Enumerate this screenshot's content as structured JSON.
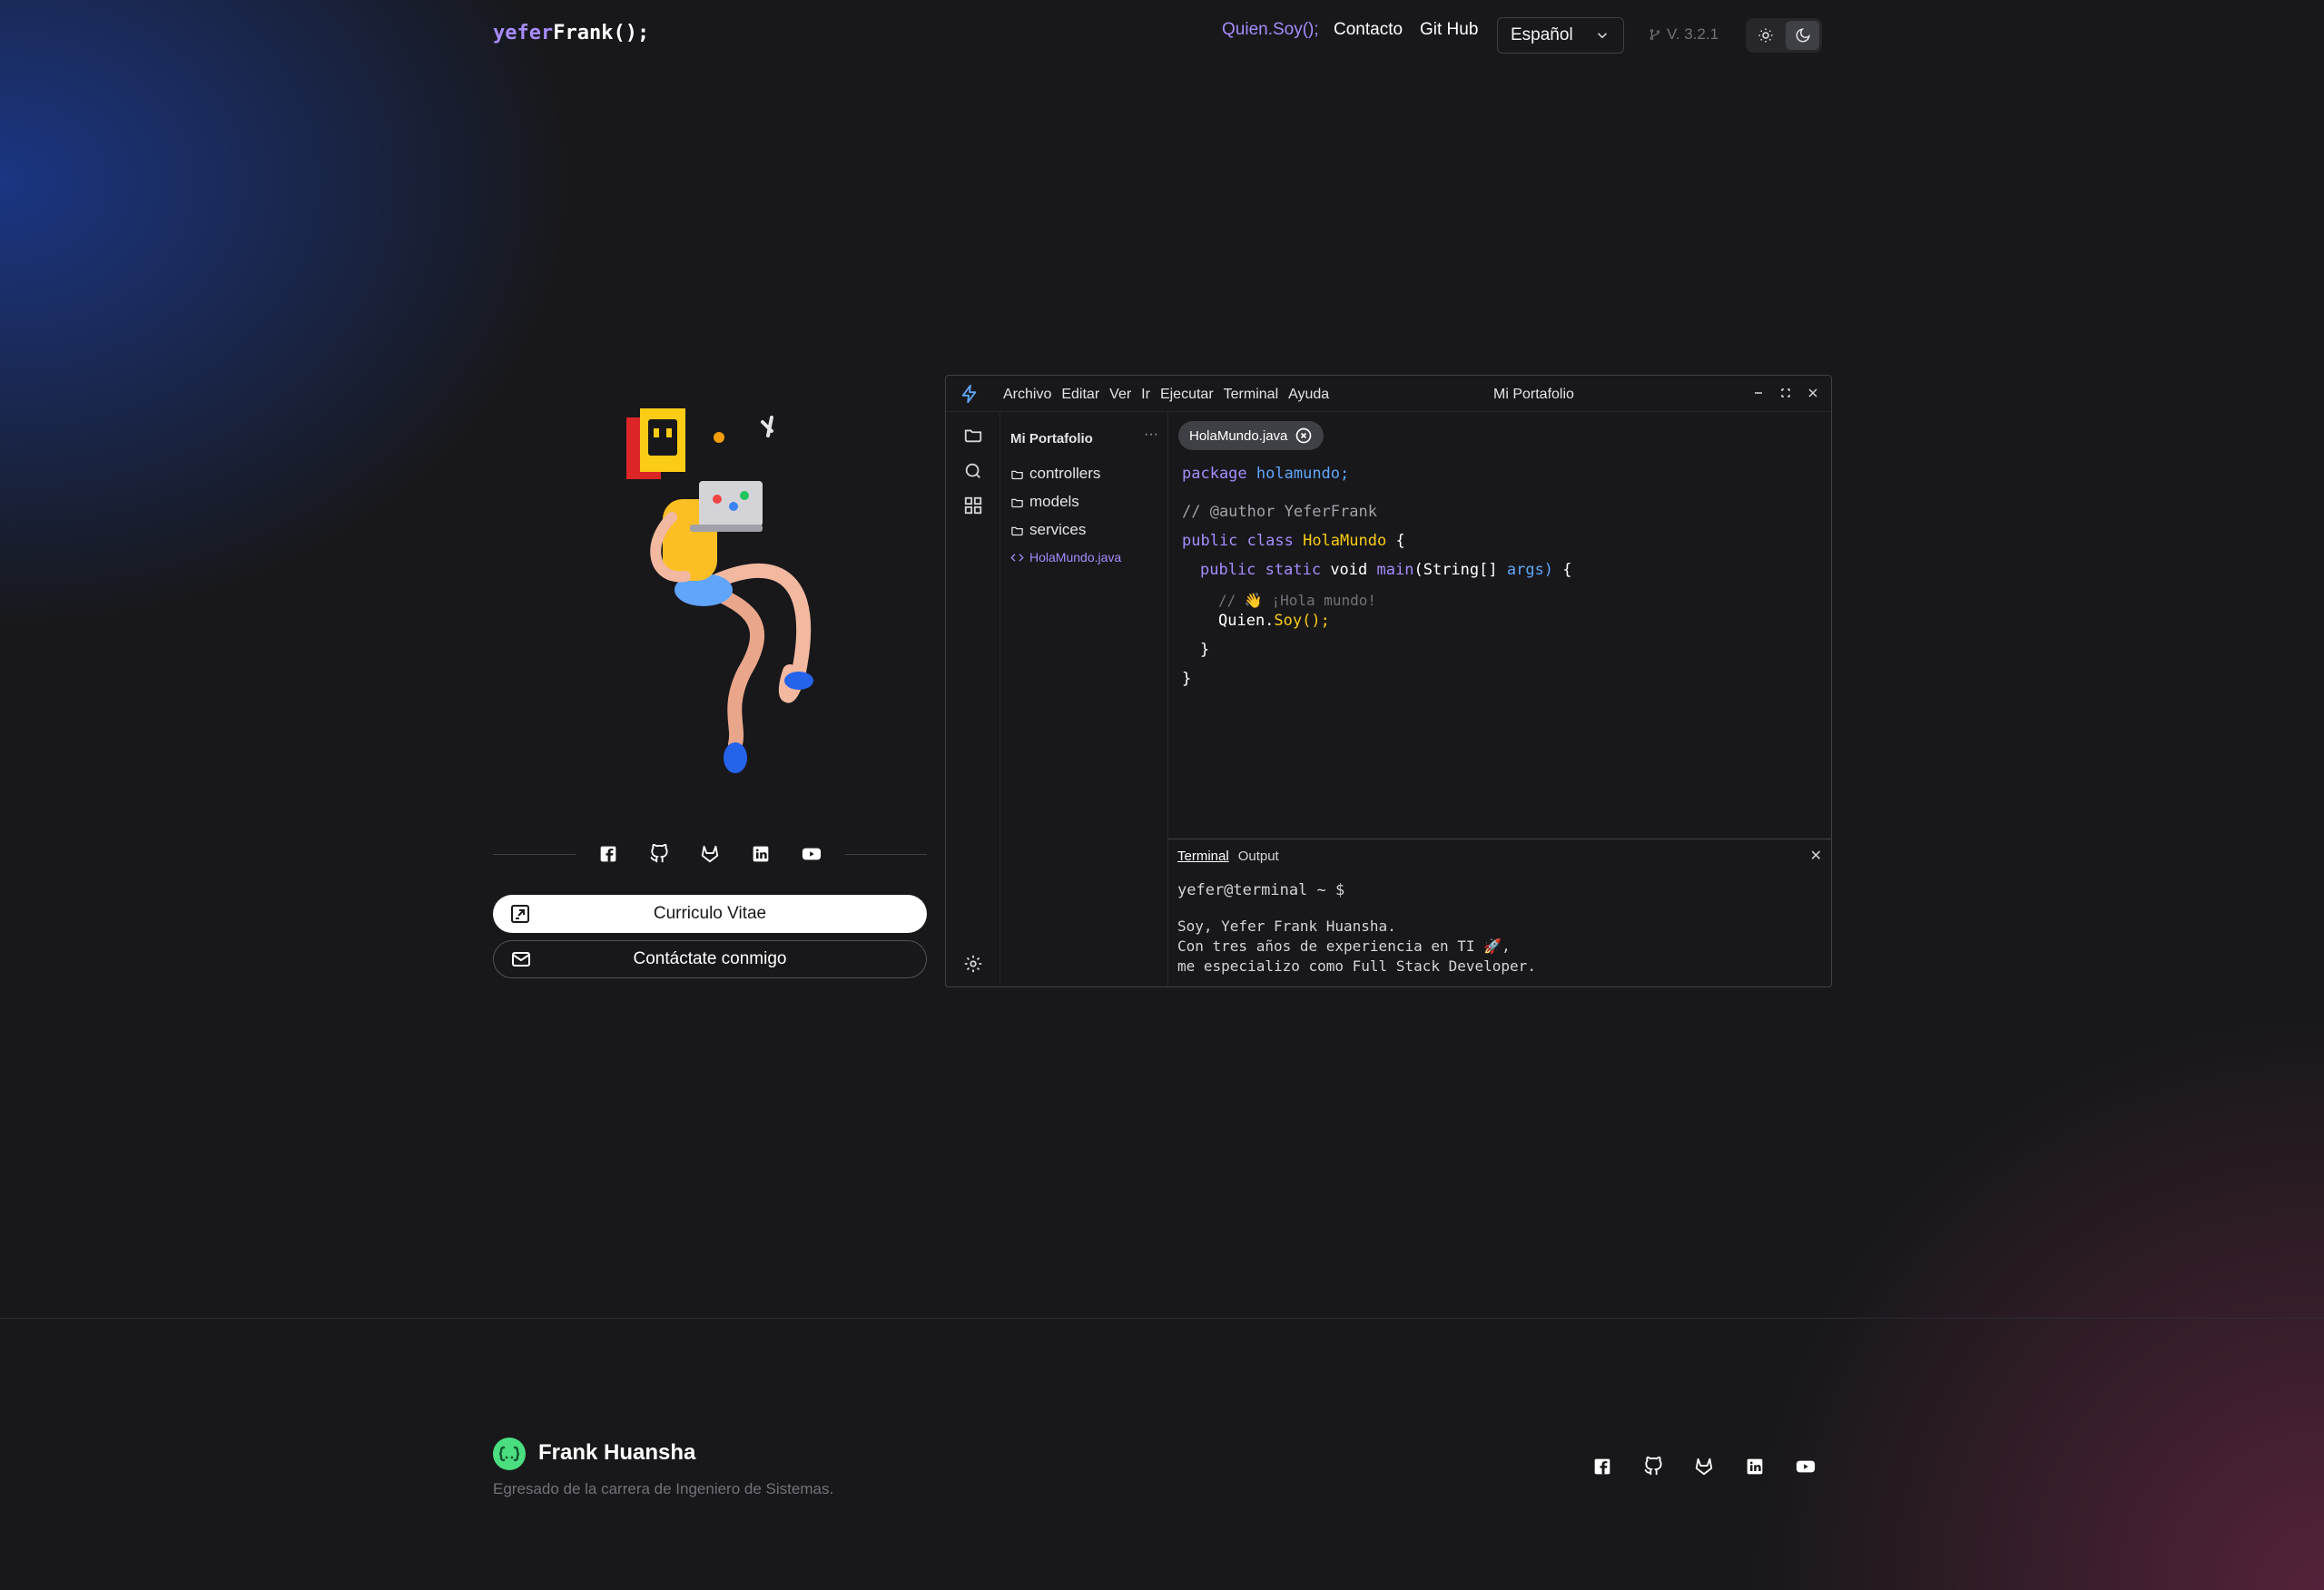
{
  "header": {
    "logo_a": "yefer",
    "logo_b": "Frank();",
    "nav": [
      "Quien.Soy();",
      "Contacto",
      "Git Hub"
    ],
    "language": "Español",
    "version": "V. 3.2.1"
  },
  "ide": {
    "menu": [
      "Archivo",
      "Editar",
      "Ver",
      "Ir",
      "Ejecutar",
      "Terminal",
      "Ayuda"
    ],
    "title": "Mi Portafolio",
    "explorer_title": "Mi Portafolio",
    "explorer_more": "···",
    "tree": [
      "controllers",
      "models",
      "services",
      "HolaMundo.java"
    ],
    "tab": "HolaMundo.java",
    "code": {
      "l1_kw": "package",
      "l1_name": "holamundo;",
      "l2": "// @author YeferFrank",
      "l3_kw": "public class",
      "l3_name": "HolaMundo",
      "l3_brace": "{",
      "l4_kw": "public static",
      "l4_void": "void",
      "l4_fn": "main",
      "l4_p1": "(",
      "l4_type": "String[]",
      "l4_arg": "args)",
      "l4_brace": "{",
      "l5": "// 👋 ¡Hola mundo!",
      "l6_obj": "Quien.",
      "l6_call": "Soy();",
      "l7": "}",
      "l8": "}"
    },
    "terminal": {
      "tab_active": "Terminal",
      "tab_other": "Output",
      "prompt": "yefer@terminal ~ $",
      "lines": [
        "Soy, Yefer Frank Huansha.",
        "Con tres años de experiencia en TI 🚀,",
        "me especializo como Full Stack Developer."
      ]
    }
  },
  "buttons": {
    "cv": "Curriculo Vitae",
    "contact": "Contáctate conmigo"
  },
  "footer": {
    "name": "Frank Huansha",
    "description": "Egresado de la carrera de Ingeniero de Sistemas."
  },
  "icons": {
    "social": [
      "facebook-icon",
      "github-icon",
      "gitlab-icon",
      "linkedin-icon",
      "youtube-icon"
    ]
  },
  "colors": {
    "accent": "#a78bfa",
    "background": "#18181b",
    "prompt_green": "#4ade80"
  }
}
